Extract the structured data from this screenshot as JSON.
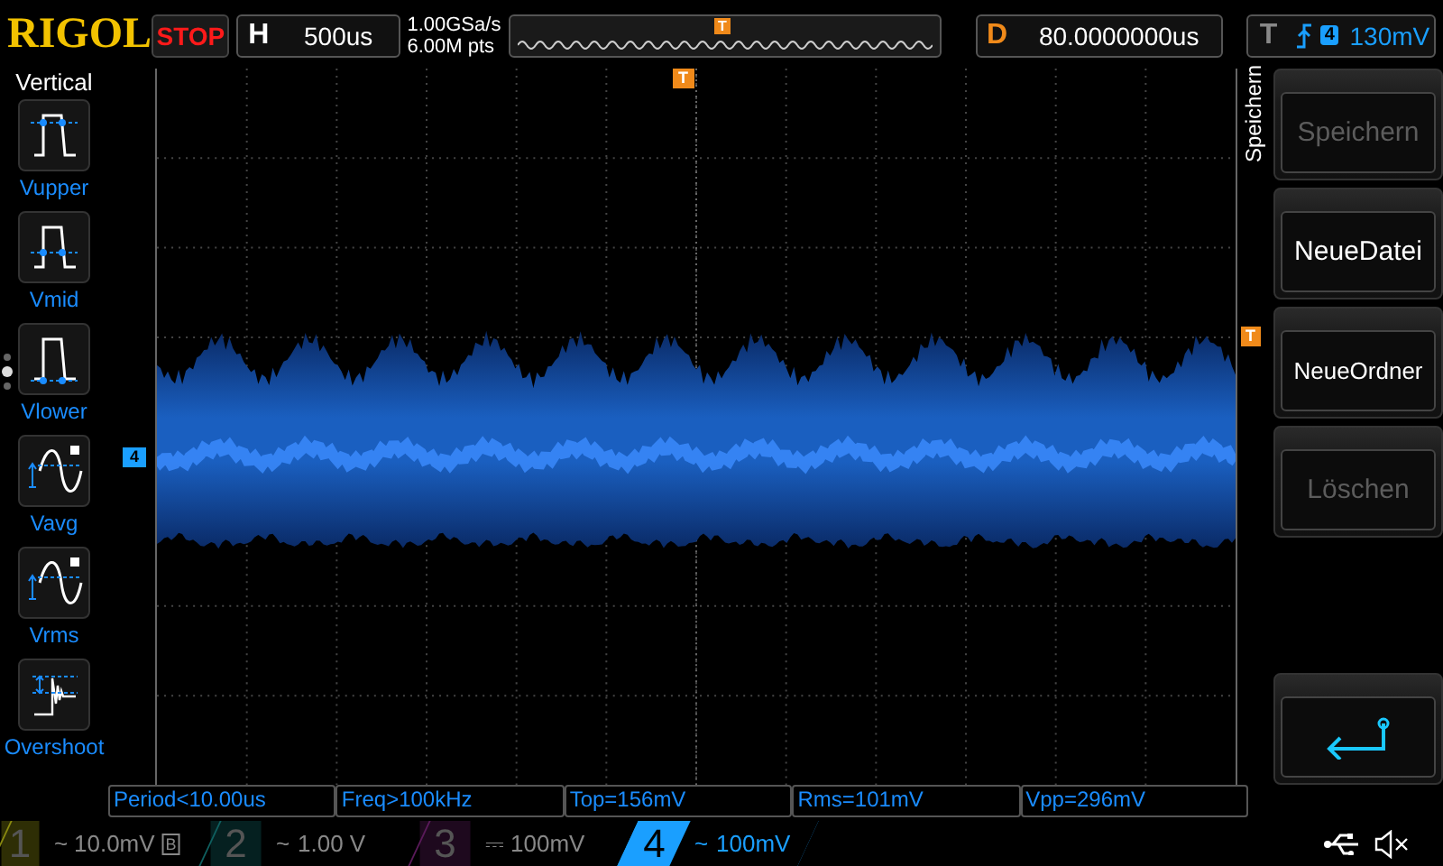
{
  "top_bar": {
    "logo": "RIGOL",
    "run_status": {
      "text": "STOP",
      "color": "#ff1a1a"
    },
    "horizontal": {
      "label": "H",
      "value": "500us"
    },
    "acquisition": {
      "sample_rate": "1.00GSa/s",
      "memory_depth": "6.00M pts"
    },
    "memory_bar": {
      "trigger_marker": "T"
    },
    "delay": {
      "label": "D",
      "value": "80.0000000us"
    },
    "trigger": {
      "label": "T",
      "source": "4",
      "level": "130mV"
    }
  },
  "side_menu": {
    "title": "Vertical",
    "items": [
      {
        "kind": "vupper",
        "label": "Vupper"
      },
      {
        "kind": "vmid",
        "label": "Vmid"
      },
      {
        "kind": "vlower",
        "label": "Vlower"
      },
      {
        "kind": "vavg",
        "label": "Vavg"
      },
      {
        "kind": "vrms",
        "label": "Vrms"
      },
      {
        "kind": "overshoot",
        "label": "Overshoot"
      }
    ],
    "page_dots": [
      {
        "selected": false
      },
      {
        "selected": true
      },
      {
        "selected": false
      }
    ]
  },
  "screen": {
    "trigger_position_marker": "T",
    "channel_marker": "4",
    "trigger_level_marker": "T"
  },
  "right_menu": {
    "title": "Speichern",
    "buttons": [
      {
        "kind": "text",
        "label": "Speichern",
        "disabled": true
      },
      {
        "kind": "text",
        "label": "NeueDatei",
        "disabled": false
      },
      {
        "kind": "text",
        "label": "NeueOrdner",
        "disabled": false
      },
      {
        "kind": "text",
        "label": "Löschen",
        "disabled": true
      },
      {
        "kind": "back"
      }
    ]
  },
  "measurements": [
    "Period<10.00us",
    "Freq>100kHz",
    "Top=156mV",
    "Rms=101mV",
    "Vpp=296mV"
  ],
  "channels": [
    {
      "name": "1",
      "coupling": "~",
      "scale": "10.0mV",
      "bw_limit": "B",
      "color": "#8a8a10",
      "selected": false
    },
    {
      "name": "2",
      "coupling": "~",
      "scale": "1.00 V",
      "color": "#0f5f5f",
      "selected": false
    },
    {
      "name": "3",
      "coupling": "⎓",
      "scale": "100mV",
      "color": "#5a1a5a",
      "selected": false
    },
    {
      "name": "4",
      "coupling": "~",
      "scale": "100mV",
      "color": "#1a9fff",
      "selected": true
    }
  ]
}
